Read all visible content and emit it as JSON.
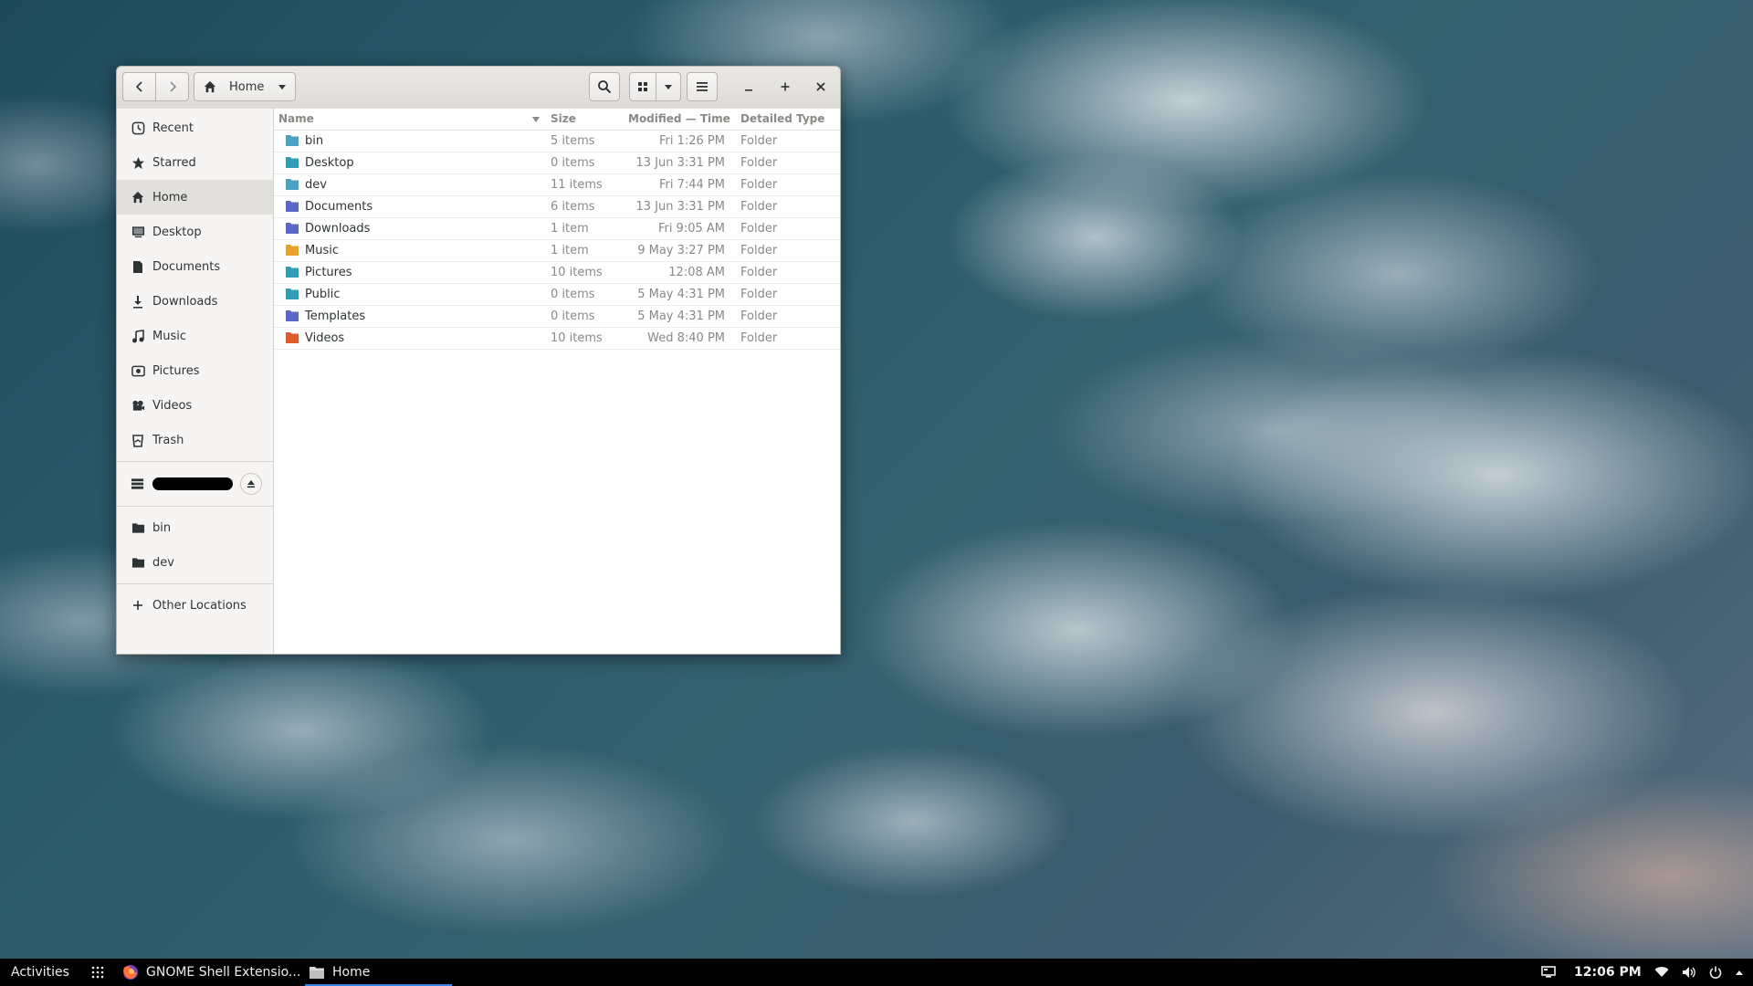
{
  "window": {
    "path_label": "Home",
    "columns": {
      "name": "Name",
      "size": "Size",
      "modified": "Modified — Time",
      "type": "Detailed Type"
    },
    "sidebar": [
      {
        "label": "Recent",
        "icon": "clock-icon"
      },
      {
        "label": "Starred",
        "icon": "star-icon"
      },
      {
        "label": "Home",
        "icon": "home-icon"
      },
      {
        "label": "Desktop",
        "icon": "desktop-icon"
      },
      {
        "label": "Documents",
        "icon": "document-icon"
      },
      {
        "label": "Downloads",
        "icon": "download-icon"
      },
      {
        "label": "Music",
        "icon": "music-icon"
      },
      {
        "label": "Pictures",
        "icon": "camera-icon"
      },
      {
        "label": "Videos",
        "icon": "videos-icon"
      },
      {
        "label": "Trash",
        "icon": "trash-icon"
      }
    ],
    "bookmarks": [
      {
        "label": "bin",
        "icon": "folder-icon"
      },
      {
        "label": "dev",
        "icon": "folder-icon"
      }
    ],
    "other_locations": "Other Locations",
    "files": [
      {
        "name": "bin",
        "size": "5 items",
        "modified": "Fri  1:26 PM",
        "type": "Folder",
        "icon": "folder-icon",
        "color": "#4aa3c2"
      },
      {
        "name": "Desktop",
        "size": "0 items",
        "modified": "13 Jun  3:31 PM",
        "type": "Folder",
        "icon": "folder-desktop-icon",
        "color": "#2e9fb5"
      },
      {
        "name": "dev",
        "size": "11 items",
        "modified": "Fri  7:44 PM",
        "type": "Folder",
        "icon": "folder-icon",
        "color": "#4aa3c2"
      },
      {
        "name": "Documents",
        "size": "6 items",
        "modified": "13 Jun  3:31 PM",
        "type": "Folder",
        "icon": "folder-documents-icon",
        "color": "#5b67c9"
      },
      {
        "name": "Downloads",
        "size": "1 item",
        "modified": "Fri  9:05 AM",
        "type": "Folder",
        "icon": "folder-download-icon",
        "color": "#5b67c9"
      },
      {
        "name": "Music",
        "size": "1 item",
        "modified": "9 May  3:27 PM",
        "type": "Folder",
        "icon": "folder-music-icon",
        "color": "#e8a22b"
      },
      {
        "name": "Pictures",
        "size": "10 items",
        "modified": "12:08 AM",
        "type": "Folder",
        "icon": "folder-pictures-icon",
        "color": "#2e9fb5"
      },
      {
        "name": "Public",
        "size": "0 items",
        "modified": "5 May  4:31 PM",
        "type": "Folder",
        "icon": "folder-public-icon",
        "color": "#2e9fb5"
      },
      {
        "name": "Templates",
        "size": "0 items",
        "modified": "5 May  4:31 PM",
        "type": "Folder",
        "icon": "folder-templates-icon",
        "color": "#5b67c9"
      },
      {
        "name": "Videos",
        "size": "10 items",
        "modified": "Wed  8:40 PM",
        "type": "Folder",
        "icon": "folder-videos-icon",
        "color": "#e05a2b"
      }
    ]
  },
  "taskbar": {
    "activities": "Activities",
    "task1": "GNOME Shell Extensio...",
    "task2": "Home",
    "clock": "12:06 PM"
  }
}
